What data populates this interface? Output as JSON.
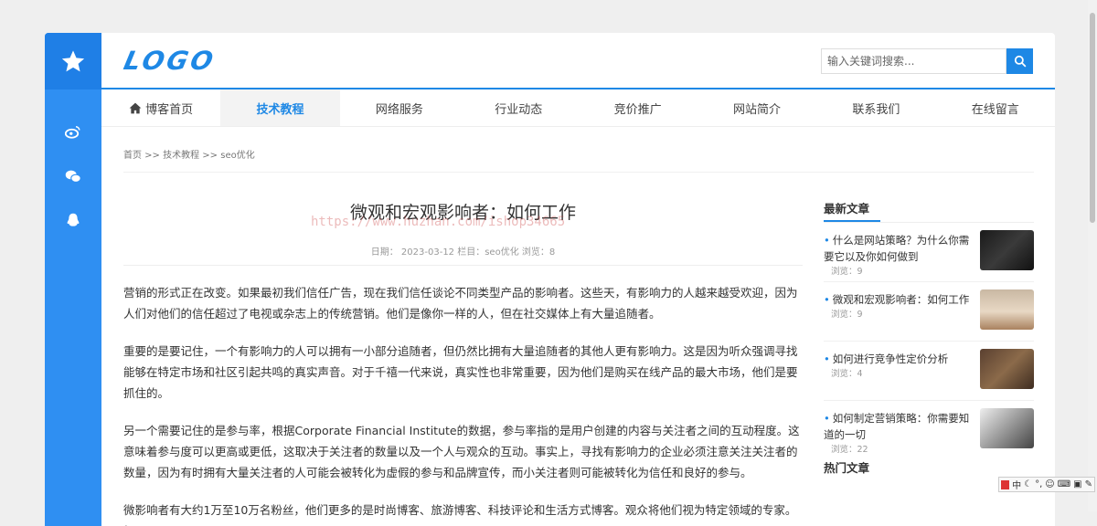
{
  "header": {
    "logo": "LOGO",
    "search_placeholder": "输入关键词搜索..."
  },
  "nav": [
    {
      "label": "博客首页",
      "icon": "home-icon"
    },
    {
      "label": "技术教程",
      "active": true
    },
    {
      "label": "网络服务"
    },
    {
      "label": "行业动态"
    },
    {
      "label": "竞价推广"
    },
    {
      "label": "网站简介"
    },
    {
      "label": "联系我们"
    },
    {
      "label": "在线留言"
    }
  ],
  "breadcrumb": "首页 >> 技术教程 >> seo优化",
  "article": {
    "title": "微观和宏观影响者：如何工作",
    "meta": "日期： 2023-03-12  栏目：seo优化  浏览：8",
    "paragraphs": [
      "营销的形式正在改变。如果最初我们信任广告，现在我们信任谈论不同类型产品的影响者。这些天，有影响力的人越来越受欢迎，因为人们对他们的信任超过了电视或杂志上的传统营销。他们是像你一样的人，但在社交媒体上有大量追随者。",
      "重要的是要记住，一个有影响力的人可以拥有一小部分追随者，但仍然比拥有大量追随者的其他人更有影响力。这是因为听众强调寻找能够在特定市场和社区引起共鸣的真实声音。对于千禧一代来说，真实性也非常重要，因为他们是购买在线产品的最大市场，他们是要抓住的。",
      "另一个需要记住的是参与率，根据Corporate Financial Institute的数据，参与率指的是用户创建的内容与关注者之间的互动程度。这意味着参与度可以更高或更低，这取决于关注者的数量以及一个人与观众的互动。事实上，寻找有影响力的企业必须注意关注关注者的数量，因为有时拥有大量关注者的人可能会被转化为虚假的参与和品牌宣传，而小关注者则可能被转化为信任和良好的参与。",
      "微影响者有大约1万至10万名粉丝，他们更多的是时尚博客、旅游博客、科技评论和生活方式博客。观众将他们视为特定领域的专家。假"
    ]
  },
  "watermark": "https://www.huzhan.com/ishop34665",
  "sidebar_right": {
    "latest_title": "最新文章",
    "posts": [
      {
        "title": "什么是网站策略？为什么你需要它以及你如何做到",
        "views": "浏览：9"
      },
      {
        "title": "微观和宏观影响者：如何工作",
        "views": "浏览：9"
      },
      {
        "title": "如何进行竞争性定价分析",
        "views": "浏览：4"
      },
      {
        "title": "如何制定营销策略：你需要知道的一切",
        "views": "浏览：22"
      }
    ],
    "hot_title": "热门文章"
  },
  "colors": {
    "accent": "#1e88e5",
    "sidebar": "#2f8ff2"
  }
}
